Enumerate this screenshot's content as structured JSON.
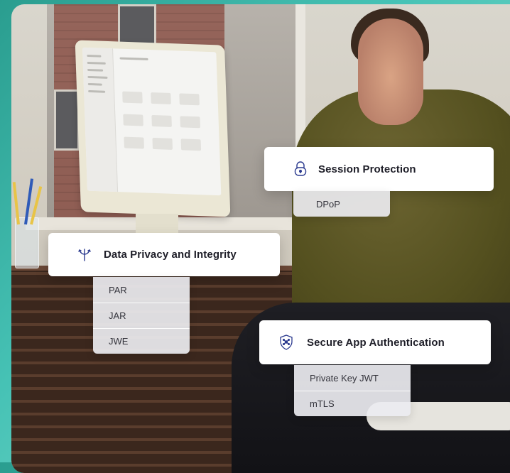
{
  "cards": {
    "session_protection": {
      "title": "Session Protection",
      "icon": "lock-icon",
      "items": [
        "DPoP"
      ]
    },
    "data_privacy": {
      "title": "Data Privacy and Integrity",
      "icon": "branch-icon",
      "items": [
        "PAR",
        "JAR",
        "JWE"
      ]
    },
    "secure_app_auth": {
      "title": "Secure App Authentication",
      "icon": "shield-network-icon",
      "items": [
        "Private Key JWT",
        "mTLS"
      ]
    }
  },
  "colors": {
    "background_accent": "#46c2b5",
    "icon_color": "#2b3a8f",
    "card_bg": "#ffffff"
  }
}
